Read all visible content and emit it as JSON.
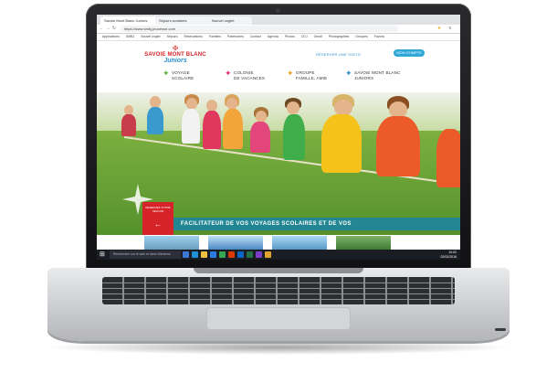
{
  "browser": {
    "tabs": [
      "Savoie Mont Blanc Juniors",
      "Séjours scolaires",
      "Nouvel onglet"
    ],
    "url": "https://www.smbj-jeunesse.com",
    "bookmarks": [
      "Applications",
      "SMBJ",
      "Nouvel onglet",
      "Séjours",
      "Réservations",
      "Familles",
      "Partenaires",
      "Contact",
      "Agenda",
      "Photos",
      "CDJ",
      "Gmail",
      "Photographies",
      "Groupes",
      "Favoris"
    ]
  },
  "site": {
    "logo_line1": "SAVOIE MONT BLANC",
    "logo_line2": "Juniors",
    "reserve_link": "RÉSERVER UNE VISITE",
    "account_button": "MON COMPTE",
    "menu": [
      {
        "line1": "VOYAGE",
        "line2": "SCOLAIRE",
        "color": "#5db53a"
      },
      {
        "line1": "COLONIE",
        "line2": "DE VACANCES",
        "color": "#e2307c"
      },
      {
        "line1": "GROUPE",
        "line2": "FAMILLE, AMIE",
        "color": "#f0a22a"
      },
      {
        "line1": "SAVOIE MONT BLANC",
        "line2": "JUNIORS",
        "color": "#2f8fc8"
      }
    ],
    "promo_text": "RESERVEZ VOTRE SÉJOUR",
    "banner_text": "FACILITATEUR DE VOS VOYAGES SCOLAIRES ET DE VOS"
  },
  "taskbar": {
    "search_placeholder": "Rechercher sur le web et dans Windows",
    "time": "10:02",
    "date": "02/02/2016"
  },
  "colors": {
    "brand_red": "#d6232a",
    "brand_blue": "#2f8fc8",
    "banner_teal": "#1682aa"
  }
}
